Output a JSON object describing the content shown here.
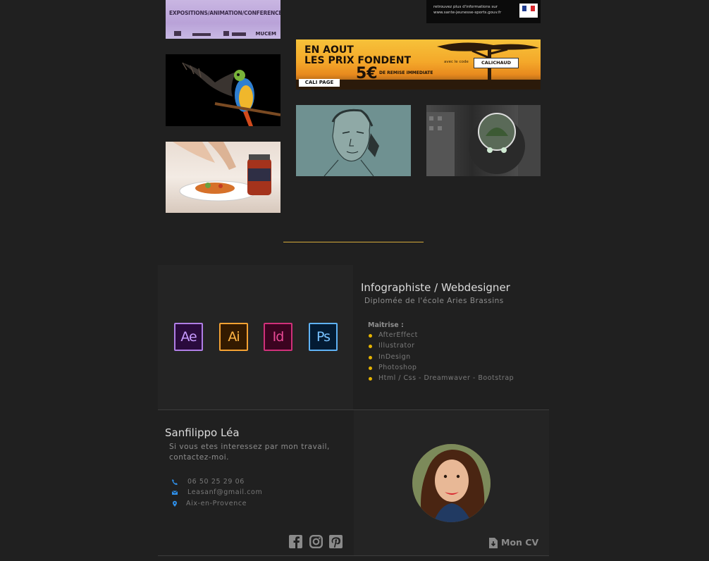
{
  "gallery": {
    "expo": {
      "headline": "EXPOSITIONS/ANIMATION/CONFERENCES",
      "logo_text": "MUCEM"
    },
    "sante": {
      "line1": "retrouvez plus d'informations sur",
      "line2": "www.sante-jeunesse-sports.gouv.fr"
    },
    "cali": {
      "headline_1": "EN AOUT",
      "headline_2": "LES PRIX FONDENT",
      "amount": "5€",
      "remise": "DE REMISE IMMEDIATE",
      "code_intro": "avec le code",
      "code": "CALICHAUD",
      "brand": "CALI PAGE"
    }
  },
  "about": {
    "apps": [
      {
        "label": "Ae",
        "icon": "after-effects-icon",
        "color": "#b07ee6"
      },
      {
        "label": "Ai",
        "icon": "illustrator-icon",
        "color": "#f4a233"
      },
      {
        "label": "Id",
        "icon": "indesign-icon",
        "color": "#d0307a"
      },
      {
        "label": "Ps",
        "icon": "photoshop-icon",
        "color": "#5fb2f5"
      }
    ],
    "job_title": "Infographiste / Webdesigner",
    "diploma": "Diplomée de l'école Aries Brassins",
    "skills_label": "Maitrise :",
    "skills": [
      "AfterEffect",
      "Illustrator",
      "InDesign",
      "Photoshop",
      "Html / Css - Dreamwaver - Bootstrap"
    ],
    "accent_color": "#d6aa3a"
  },
  "contact": {
    "name": "Sanfilippo Léa",
    "intro_1": "Si vous etes interessez par mon travail,",
    "intro_2": "contactez-moi.",
    "phone": "06 50 25 29 06",
    "email": "Leasanf@gmail.com",
    "location": "Aix-en-Provence",
    "icon_color": "#2f8fe8",
    "social": [
      "facebook-icon",
      "instagram-icon",
      "pinterest-icon"
    ],
    "cv_label": "Mon CV"
  }
}
